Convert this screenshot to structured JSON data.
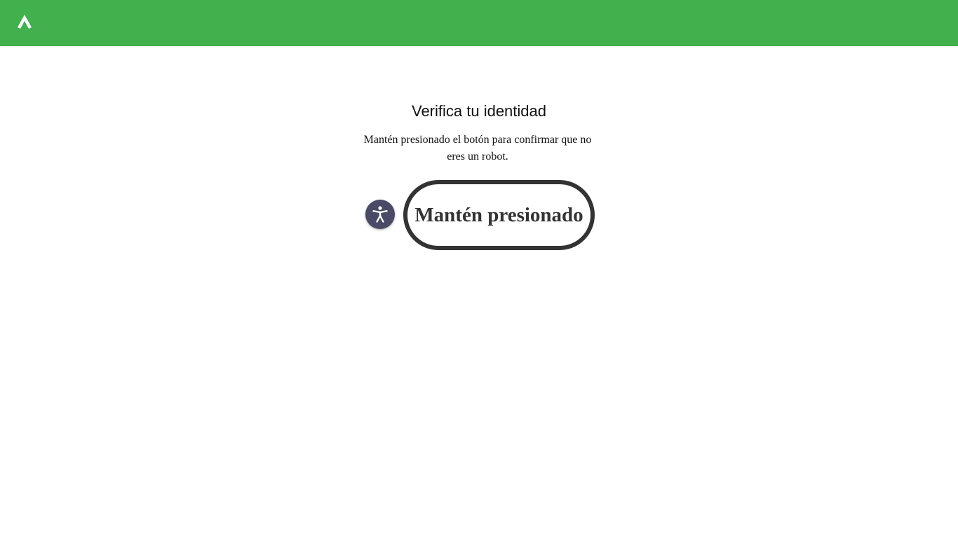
{
  "header": {
    "logo_icon": "mountain-logo-icon",
    "background_color": "#41b04d"
  },
  "verification": {
    "title": "Verifica tu identidad",
    "instructions": "Mantén presionado el botón para confirmar que no eres un robot.",
    "hold_button_label": "Mantén presionado",
    "accessibility_icon": "accessibility-icon"
  },
  "colors": {
    "accent": "#41b04d",
    "button_border": "#333333",
    "accessibility_bg": "#4a4a66"
  }
}
